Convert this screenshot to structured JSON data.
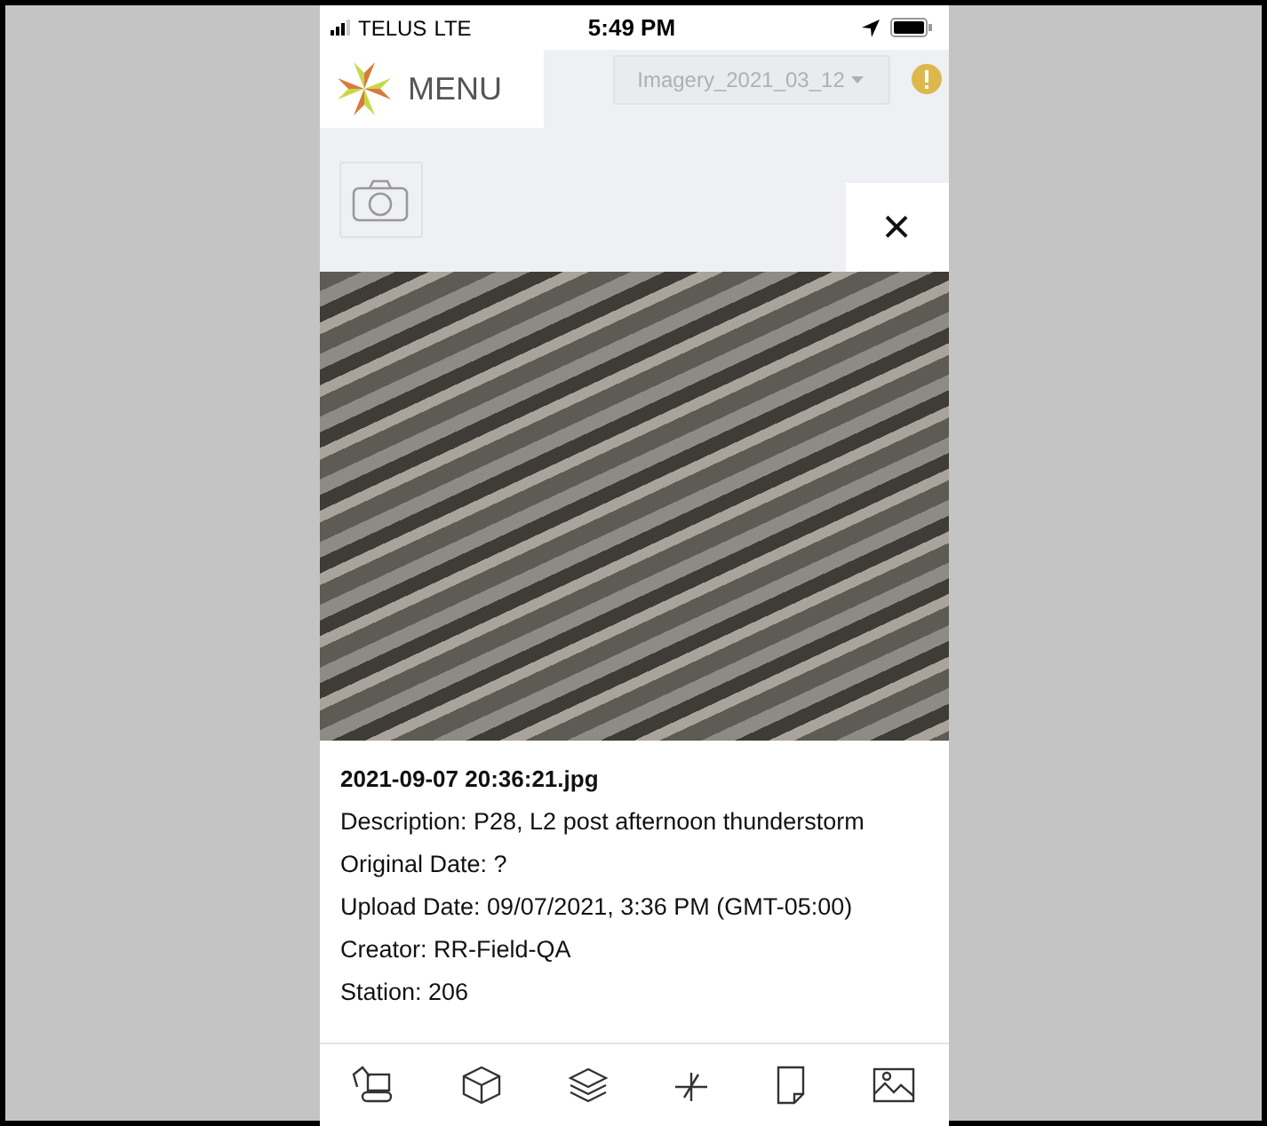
{
  "status_bar": {
    "carrier": "TELUS",
    "network": "LTE",
    "time": "5:49 PM"
  },
  "header": {
    "menu_label": "MENU",
    "dataset_dropdown": "Imagery_2021_03_12"
  },
  "viewer": {
    "close": "×"
  },
  "details": {
    "filename": "2021-09-07 20:36:21.jpg",
    "lines": [
      "Description: P28, L2 post afternoon thunderstorm",
      "Original Date: ?",
      "Upload Date: 09/07/2021, 3:36 PM (GMT-05:00)",
      "Creator: RR-Field-QA",
      "Station: 206"
    ]
  }
}
